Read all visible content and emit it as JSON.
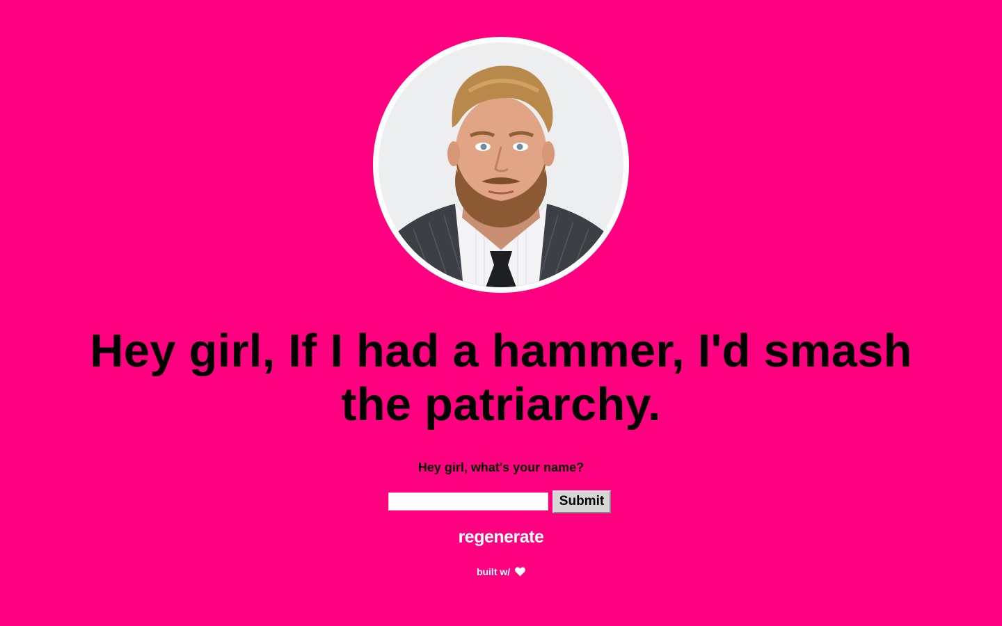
{
  "headline": "Hey girl, If I had a hammer, I'd smash the patriarchy.",
  "form": {
    "prompt": "Hey girl, what's your name?",
    "name_value": "",
    "submit_label": "Submit"
  },
  "regenerate_label": "regenerate",
  "footer": {
    "text": "built w/",
    "icon": "heart-icon"
  },
  "colors": {
    "background": "#ff0080",
    "headline": "#000000",
    "link": "#ffffff"
  }
}
